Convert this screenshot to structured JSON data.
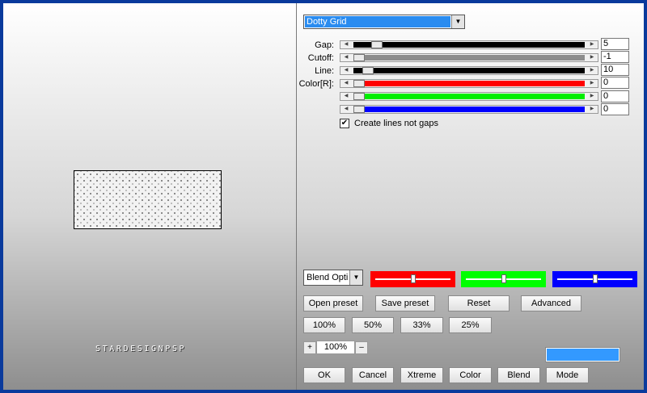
{
  "filter": {
    "preset_select": "Dotty Grid",
    "watermark": "STARDESIGNPSP",
    "params": [
      {
        "label": "Gap:",
        "value": "5",
        "fill_color": "#000000",
        "thumb_fraction": 0.08
      },
      {
        "label": "Cutoff:",
        "value": "-1",
        "fill_color": "#8c8c8c",
        "thumb_fraction": 0.0
      },
      {
        "label": "Line:",
        "value": "10",
        "fill_color": "#000000",
        "thumb_fraction": 0.04
      },
      {
        "label": "Color[R]:",
        "value": "0",
        "fill_color": "#ff0000",
        "thumb_fraction": 0.0
      },
      {
        "label": "",
        "value": "0",
        "fill_color": "#00ee00",
        "thumb_fraction": 0.0
      },
      {
        "label": "",
        "value": "0",
        "fill_color": "#0000ff",
        "thumb_fraction": 0.0
      }
    ],
    "checkbox_label": "Create lines not gaps",
    "checkbox_checked": true,
    "blend_select": "Blend Opti",
    "blend_colors": [
      {
        "color": "#ff0000",
        "level": 0.5
      },
      {
        "color": "#00ff00",
        "level": 0.5
      },
      {
        "color": "#0000ff",
        "level": 0.5
      }
    ],
    "preset_buttons": [
      "Open preset",
      "Save preset",
      "Reset",
      "Advanced"
    ],
    "zoom_buttons": [
      "100%",
      "50%",
      "33%",
      "25%"
    ],
    "zoom_value": "100%",
    "zoom_plus": "+",
    "zoom_minus": "–",
    "swatch_color": "#3399ff",
    "bottom_buttons": [
      "OK",
      "Cancel",
      "Xtreme",
      "Color",
      "Blend",
      "Mode"
    ]
  }
}
